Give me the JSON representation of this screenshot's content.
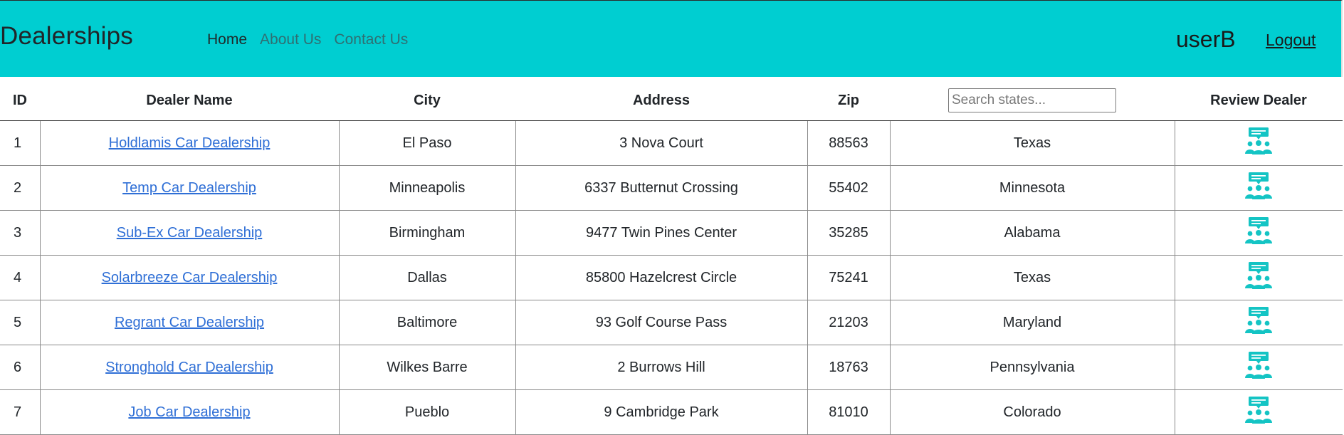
{
  "header": {
    "brand": "Dealerships",
    "nav": [
      {
        "label": "Home"
      },
      {
        "label": "About Us"
      },
      {
        "label": "Contact Us"
      }
    ],
    "username": "userB",
    "logout_label": "Logout",
    "accent_color": "#00ced1"
  },
  "table": {
    "columns": {
      "id": "ID",
      "dealer_name": "Dealer Name",
      "city": "City",
      "address": "Address",
      "zip": "Zip",
      "review": "Review Dealer"
    },
    "search_placeholder": "Search states...",
    "review_icon": "review-dealer-icon",
    "rows": [
      {
        "id": "1",
        "name": "Holdlamis Car Dealership",
        "city": "El Paso",
        "address": "3 Nova Court",
        "zip": "88563",
        "state": "Texas"
      },
      {
        "id": "2",
        "name": "Temp Car Dealership",
        "city": "Minneapolis",
        "address": "6337 Butternut Crossing",
        "zip": "55402",
        "state": "Minnesota"
      },
      {
        "id": "3",
        "name": "Sub-Ex Car Dealership",
        "city": "Birmingham",
        "address": "9477 Twin Pines Center",
        "zip": "35285",
        "state": "Alabama"
      },
      {
        "id": "4",
        "name": "Solarbreeze Car Dealership",
        "city": "Dallas",
        "address": "85800 Hazelcrest Circle",
        "zip": "75241",
        "state": "Texas"
      },
      {
        "id": "5",
        "name": "Regrant Car Dealership",
        "city": "Baltimore",
        "address": "93 Golf Course Pass",
        "zip": "21203",
        "state": "Maryland"
      },
      {
        "id": "6",
        "name": "Stronghold Car Dealership",
        "city": "Wilkes Barre",
        "address": "2 Burrows Hill",
        "zip": "18763",
        "state": "Pennsylvania"
      },
      {
        "id": "7",
        "name": "Job Car Dealership",
        "city": "Pueblo",
        "address": "9 Cambridge Park",
        "zip": "81010",
        "state": "Colorado"
      }
    ]
  }
}
